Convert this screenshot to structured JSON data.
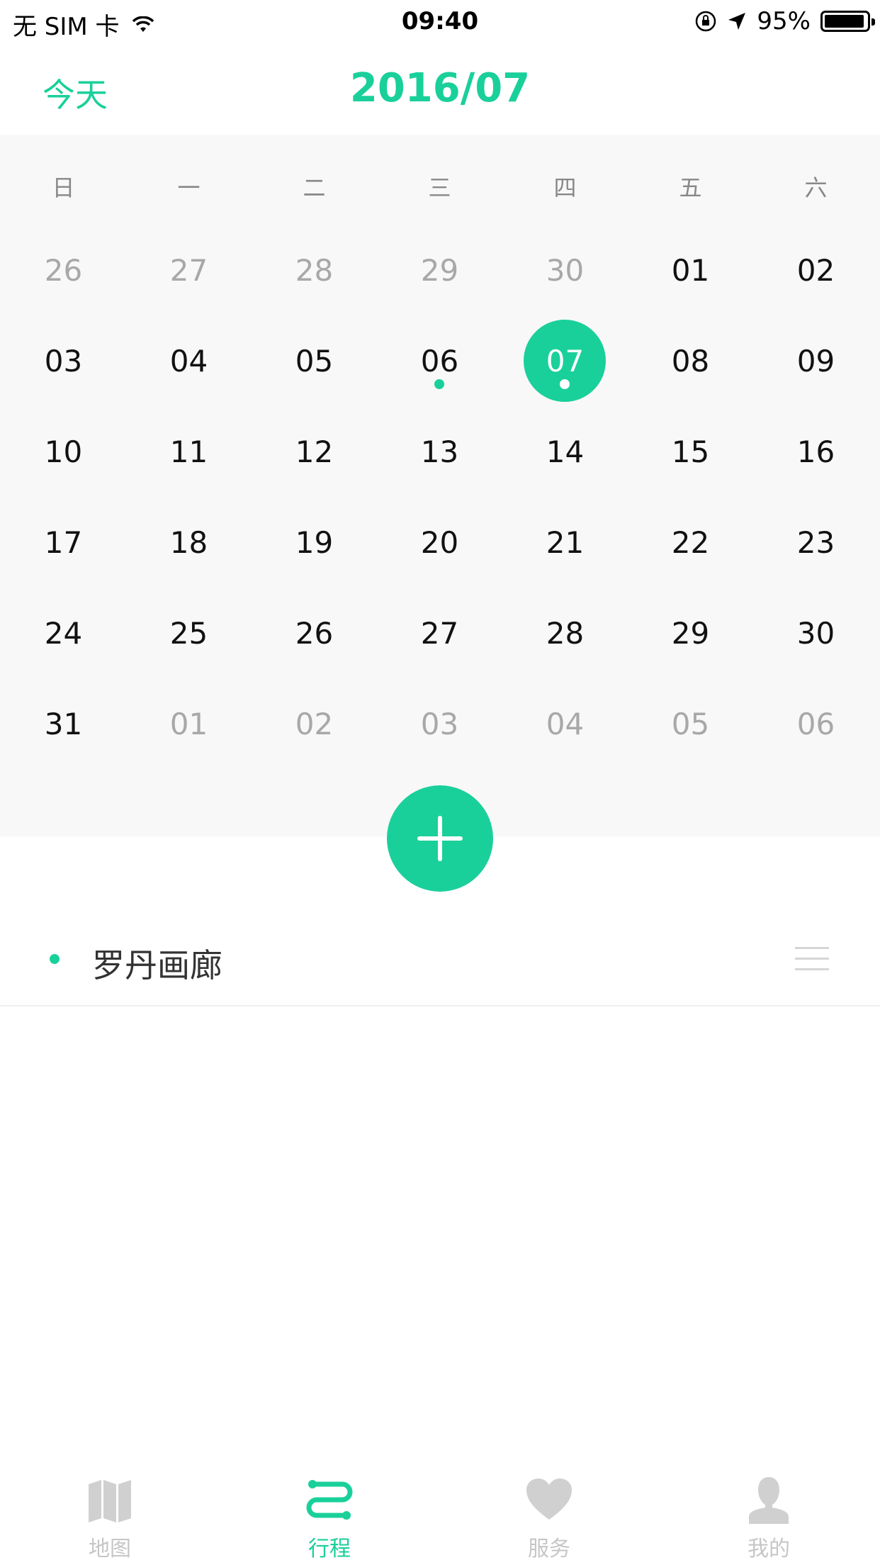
{
  "status_bar": {
    "carrier": "无 SIM 卡",
    "time": "09:40",
    "battery_percent": "95%",
    "battery_level": 0.95
  },
  "nav": {
    "today_label": "今天",
    "title": "2016/07"
  },
  "accent_color": "#1ad09a",
  "calendar": {
    "weekdays": [
      "日",
      "一",
      "二",
      "三",
      "四",
      "五",
      "六"
    ],
    "weeks": [
      [
        "26",
        "27",
        "28",
        "29",
        "30",
        "01",
        "02"
      ],
      [
        "03",
        "04",
        "05",
        "06",
        "07",
        "08",
        "09"
      ],
      [
        "10",
        "11",
        "12",
        "13",
        "14",
        "15",
        "16"
      ],
      [
        "17",
        "18",
        "19",
        "20",
        "21",
        "22",
        "23"
      ],
      [
        "24",
        "25",
        "26",
        "27",
        "28",
        "29",
        "30"
      ],
      [
        "31",
        "01",
        "02",
        "03",
        "04",
        "05",
        "06"
      ]
    ],
    "selected_day": "07",
    "event_days": [
      "06",
      "07"
    ]
  },
  "trip": {
    "item_label": "罗丹画廊"
  },
  "tabs": [
    {
      "label": "地图",
      "icon": "map-icon"
    },
    {
      "label": "行程",
      "icon": "route-icon",
      "active": true
    },
    {
      "label": "服务",
      "icon": "heart-icon"
    },
    {
      "label": "我的",
      "icon": "person-icon"
    }
  ]
}
